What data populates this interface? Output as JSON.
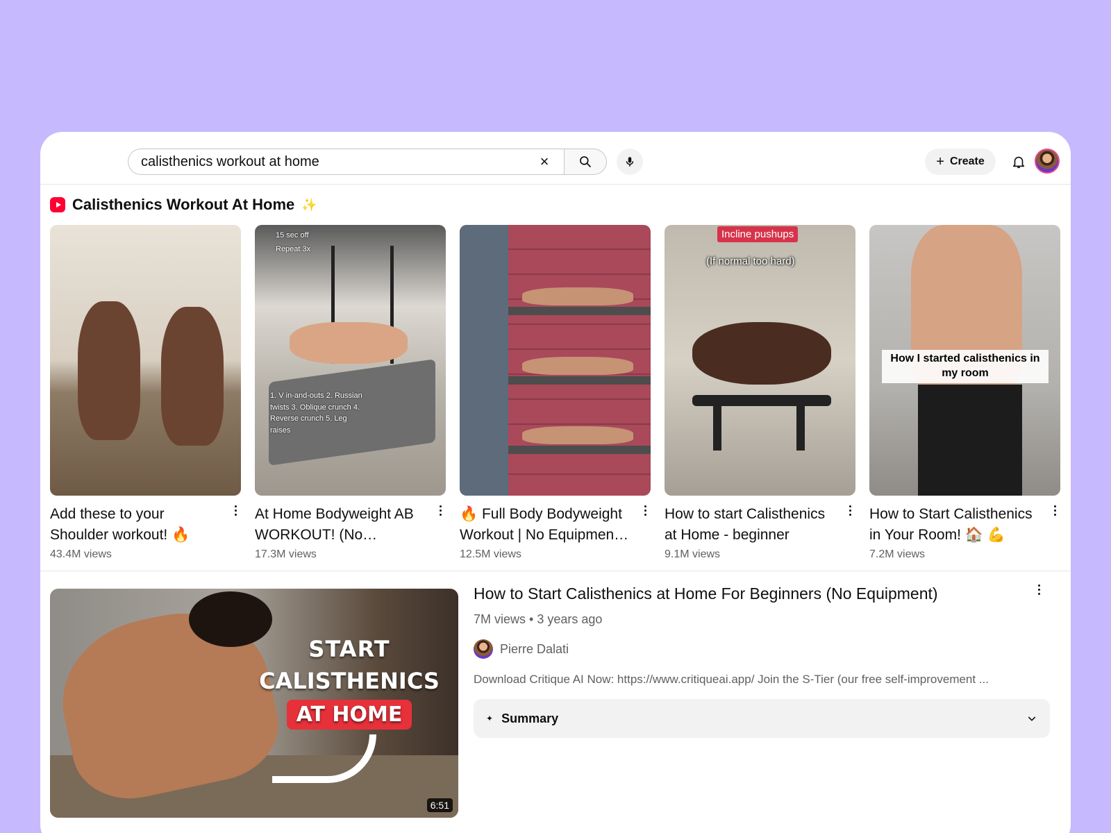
{
  "search": {
    "query": "calisthenics workout at home",
    "clear_icon": "×"
  },
  "header": {
    "create_label": "Create",
    "create_icon": "+"
  },
  "shorts": {
    "title": "Calisthenics Workout At Home",
    "title_emoji": "✨",
    "items": [
      {
        "title": "Add these to your Shoulder workout! 🔥",
        "views": "43.4M views",
        "overlay": ""
      },
      {
        "title": "At Home Bodyweight AB WORKOUT! (No…",
        "views": "17.3M views",
        "overlay_top": "15 sec off\nRepeat 3x",
        "overlay": "1. V in-and-outs 2. Russian twists 3. Oblique crunch 4. Reverse crunch 5. Leg raises"
      },
      {
        "title": "🔥 Full Body Bodyweight Workout | No Equipmen…",
        "views": "12.5M views",
        "overlay": ""
      },
      {
        "title": "How to start Calisthenics at Home - beginner",
        "views": "9.1M views",
        "overlay_red": "Incline pushups",
        "overlay_white": "(If normal too hard)"
      },
      {
        "title": "How to Start Calisthenics in Your Room! 🏠 💪",
        "views": "7.2M views",
        "overlay_box": "How I started calisthenics in my room"
      }
    ]
  },
  "video": {
    "title": "How to Start Calisthenics at Home For Beginners (No Equipment)",
    "meta": "7M views • 3 years ago",
    "channel": "Pierre Dalati",
    "description": "Download Critique AI Now: https://www.critiqueai.app/ Join the S-Tier (our free self-improvement ...",
    "summary_label": "Summary",
    "duration": "6:51",
    "thumb_line1": "START",
    "thumb_line2": "CALISTHENICS",
    "thumb_line3": "AT HOME"
  },
  "colors": {
    "background": "#c7b9fd",
    "shorts_brand": "#ff0033",
    "muted_text": "#606060"
  }
}
